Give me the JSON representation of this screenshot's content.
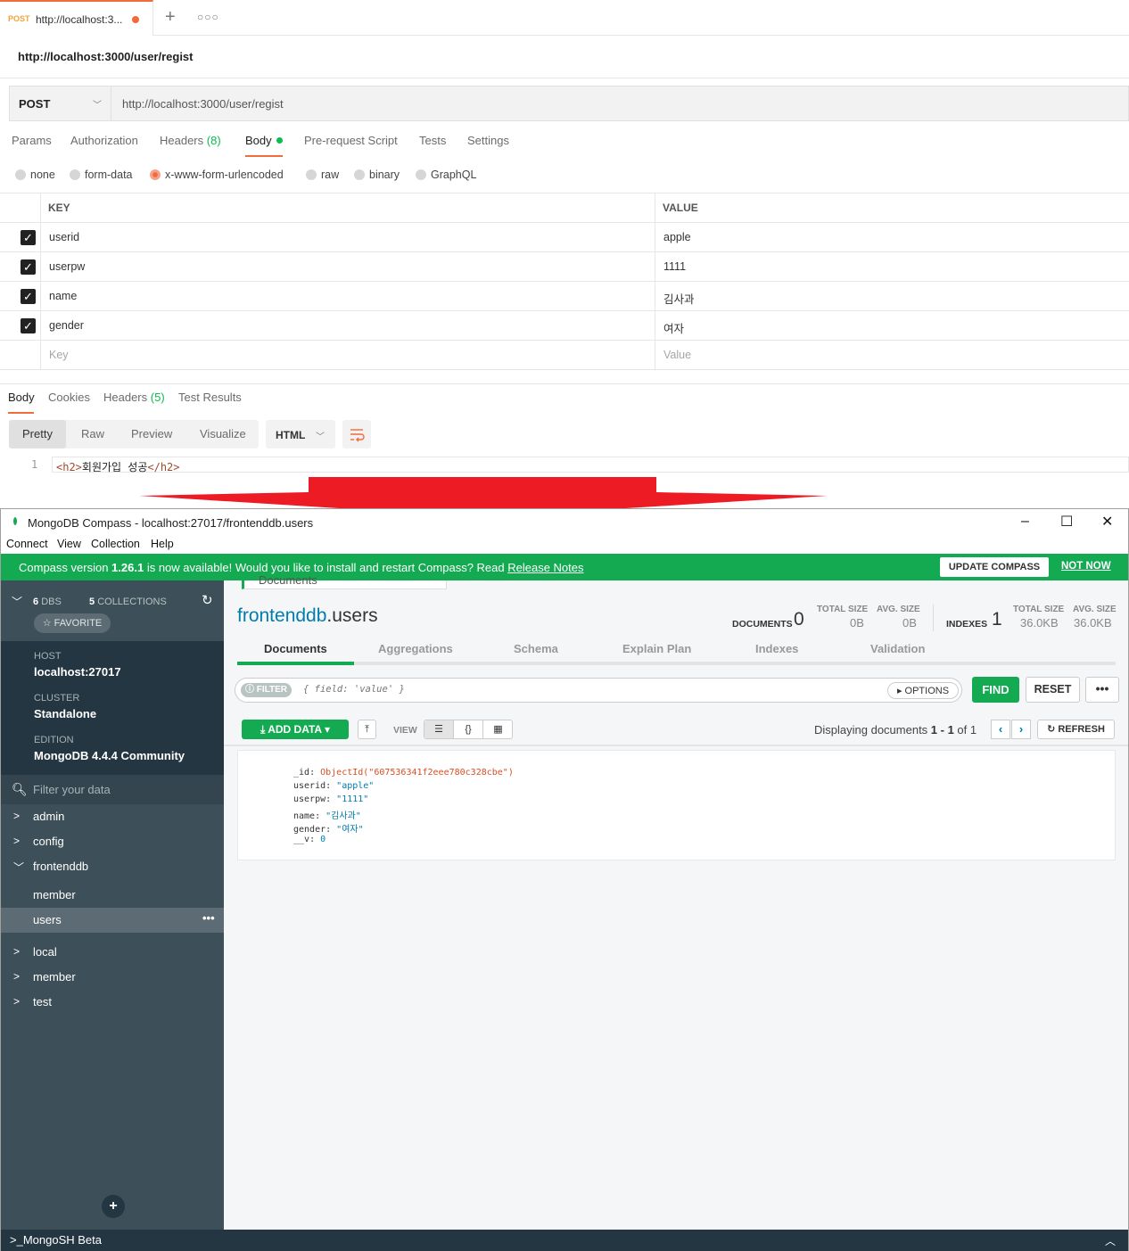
{
  "postman": {
    "tab": {
      "method": "POST",
      "url": "http://localhost:3..."
    },
    "title": "http://localhost:3000/user/regist",
    "method": "POST",
    "url": "http://localhost:3000/user/regist",
    "request_tabs": {
      "params": "Params",
      "authorization": "Authorization",
      "headers": "Headers",
      "headers_count": "(8)",
      "body": "Body",
      "prerequest": "Pre-request Script",
      "tests": "Tests",
      "settings": "Settings"
    },
    "body_types": {
      "none": "none",
      "form_data": "form-data",
      "urlencoded": "x-www-form-urlencoded",
      "raw": "raw",
      "binary": "binary",
      "graphql": "GraphQL"
    },
    "selected_body_type": "x-www-form-urlencoded",
    "table": {
      "key_header": "KEY",
      "value_header": "VALUE",
      "rows": [
        {
          "key": "userid",
          "value": "apple"
        },
        {
          "key": "userpw",
          "value": "1111"
        },
        {
          "key": "name",
          "value": "김사과"
        },
        {
          "key": "gender",
          "value": "여자"
        }
      ],
      "key_placeholder": "Key",
      "value_placeholder": "Value"
    },
    "response_tabs": {
      "body": "Body",
      "cookies": "Cookies",
      "headers": "Headers",
      "headers_count": "(5)",
      "test_results": "Test Results"
    },
    "view_modes": {
      "pretty": "Pretty",
      "raw": "Raw",
      "preview": "Preview",
      "visualize": "Visualize"
    },
    "format": "HTML",
    "code": {
      "line": "1",
      "open_tag": "<h2>",
      "text": "회원가입 성공",
      "close_tag": "</h2>"
    }
  },
  "compass": {
    "window_title": "MongoDB Compass - localhost:27017/frontenddb.users",
    "menu": {
      "connect": "Connect",
      "view": "View",
      "collection": "Collection",
      "help": "Help"
    },
    "banner": {
      "pre": "Compass version ",
      "version": "1.26.1",
      "mid": " is now available! Would you like to install and restart Compass? Read ",
      "link": "Release Notes",
      "update": "UPDATE COMPASS",
      "not_now": "NOT NOW"
    },
    "sidebar": {
      "dbs_count": "6",
      "dbs_label": "DBS",
      "collections_count": "5",
      "collections_label": "COLLECTIONS",
      "favorite": "☆ FAVORITE",
      "host_label": "HOST",
      "host": "localhost:27017",
      "cluster_label": "CLUSTER",
      "cluster": "Standalone",
      "edition_label": "EDITION",
      "edition": "MongoDB 4.4.4 Community",
      "filter_placeholder": "Filter your data",
      "dbs": {
        "admin": "admin",
        "config": "config",
        "frontenddb": "frontenddb",
        "member_col": "member",
        "users_col": "users",
        "local": "local",
        "member": "member",
        "test": "test"
      },
      "shell": ">_MongoSH Beta"
    },
    "main": {
      "breadcrumb_tab": "Documents",
      "db": "frontenddb",
      "collection": ".users",
      "documents_label": "DOCUMENTS",
      "documents_count": "0",
      "total_size_label": "TOTAL SIZE",
      "avg_size_label": "AVG. SIZE",
      "doc_total_size": "0B",
      "doc_avg_size": "0B",
      "indexes_label": "INDEXES",
      "indexes_count": "1",
      "idx_total_size": "36.0KB",
      "idx_avg_size": "36.0KB",
      "tabs": {
        "documents": "Documents",
        "aggregations": "Aggregations",
        "schema": "Schema",
        "explain": "Explain Plan",
        "indexes": "Indexes",
        "validation": "Validation"
      },
      "filter_label": "FILTER",
      "filter_placeholder": "{ field: 'value' }",
      "options": "OPTIONS",
      "find": "FIND",
      "reset": "RESET",
      "more": "•••",
      "add_data": "ADD DATA",
      "view_label": "VIEW",
      "display_pre": "Displaying documents ",
      "display_range": "1 - 1",
      "display_of": " of 1",
      "refresh": "REFRESH"
    },
    "document": [
      {
        "k": "_id",
        "v": "ObjectId(\"607536341f2eee780c328cbe\")",
        "t": "o"
      },
      {
        "k": "userid",
        "v": "\"apple\"",
        "t": "s"
      },
      {
        "k": "userpw",
        "v": "\"1111\"",
        "t": "s"
      },
      {
        "k": "name",
        "v": "\"김사과\"",
        "t": "s"
      },
      {
        "k": "gender",
        "v": "\"여자\"",
        "t": "s"
      },
      {
        "k": "__v",
        "v": "0",
        "t": "n"
      }
    ],
    "colors": {
      "green": "#13aa52",
      "sidebar": "#3d4f58",
      "sidebar_dark": "#243642",
      "link": "#007cad"
    }
  },
  "arrow_color": "#ed1c24"
}
